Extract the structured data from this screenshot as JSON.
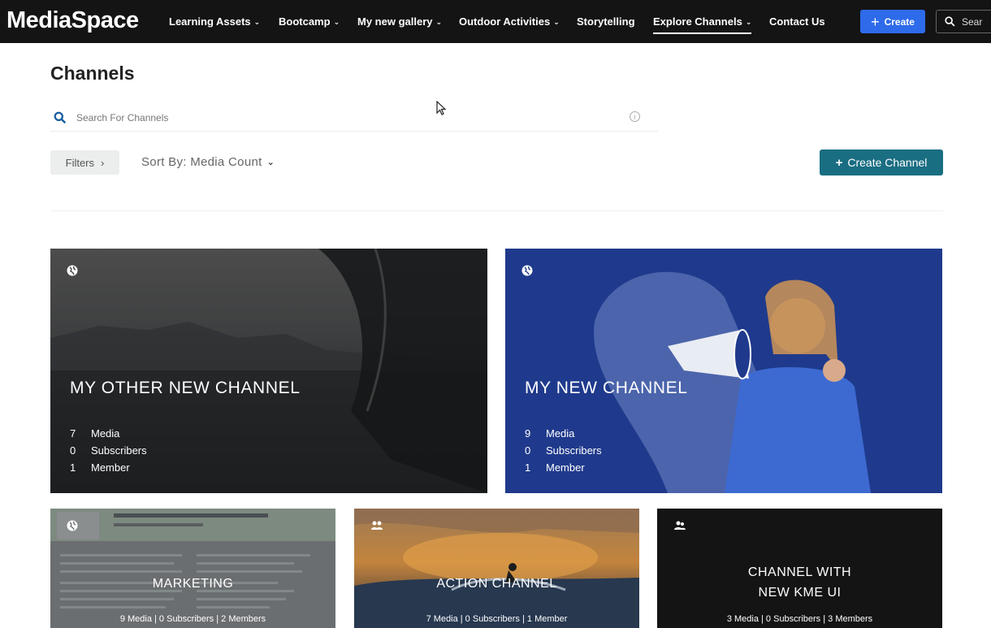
{
  "brand": "MediaSpace",
  "nav": [
    {
      "label": "Learning Assets",
      "has_menu": true
    },
    {
      "label": "Bootcamp",
      "has_menu": true
    },
    {
      "label": "My new gallery",
      "has_menu": true
    },
    {
      "label": "Outdoor Activities",
      "has_menu": true
    },
    {
      "label": "Storytelling",
      "has_menu": false
    },
    {
      "label": "Explore Channels",
      "has_menu": true
    },
    {
      "label": "Contact Us",
      "has_menu": false
    }
  ],
  "header_actions": {
    "create_label": "Create",
    "search_label": "Sear"
  },
  "page": {
    "title": "Channels",
    "search_placeholder": "Search For Channels",
    "filters_label": "Filters",
    "sort_label": "Sort By: Media Count",
    "create_channel_label": "Create Channel"
  },
  "channels": [
    {
      "title": "MY OTHER NEW CHANNEL",
      "media": "7",
      "media_label": "Media",
      "subscribers": "0",
      "subscribers_label": "Subscribers",
      "members": "1",
      "members_label": "Member",
      "icon": "globe-icon"
    },
    {
      "title": "MY NEW CHANNEL",
      "media": "9",
      "media_label": "Media",
      "subscribers": "0",
      "subscribers_label": "Subscribers",
      "members": "1",
      "members_label": "Member",
      "icon": "globe-icon"
    },
    {
      "title": "MARKETING",
      "stats": "9 Media | 0 Subscribers | 2 Members",
      "icon": "globe-icon"
    },
    {
      "title": "ACTION CHANNEL",
      "stats": "7 Media | 0 Subscribers | 1 Member",
      "icon": "users-icon"
    },
    {
      "title_line1": "CHANNEL WITH",
      "title_line2": "NEW KME UI",
      "stats": "3 Media | 0 Subscribers | 3 Members",
      "icon": "users-icon"
    }
  ],
  "colors": {
    "topbar": "#141414",
    "create_button": "#2e6bea",
    "create_channel_button": "#1a6e82",
    "card2_bg": "#1f3a8c"
  }
}
